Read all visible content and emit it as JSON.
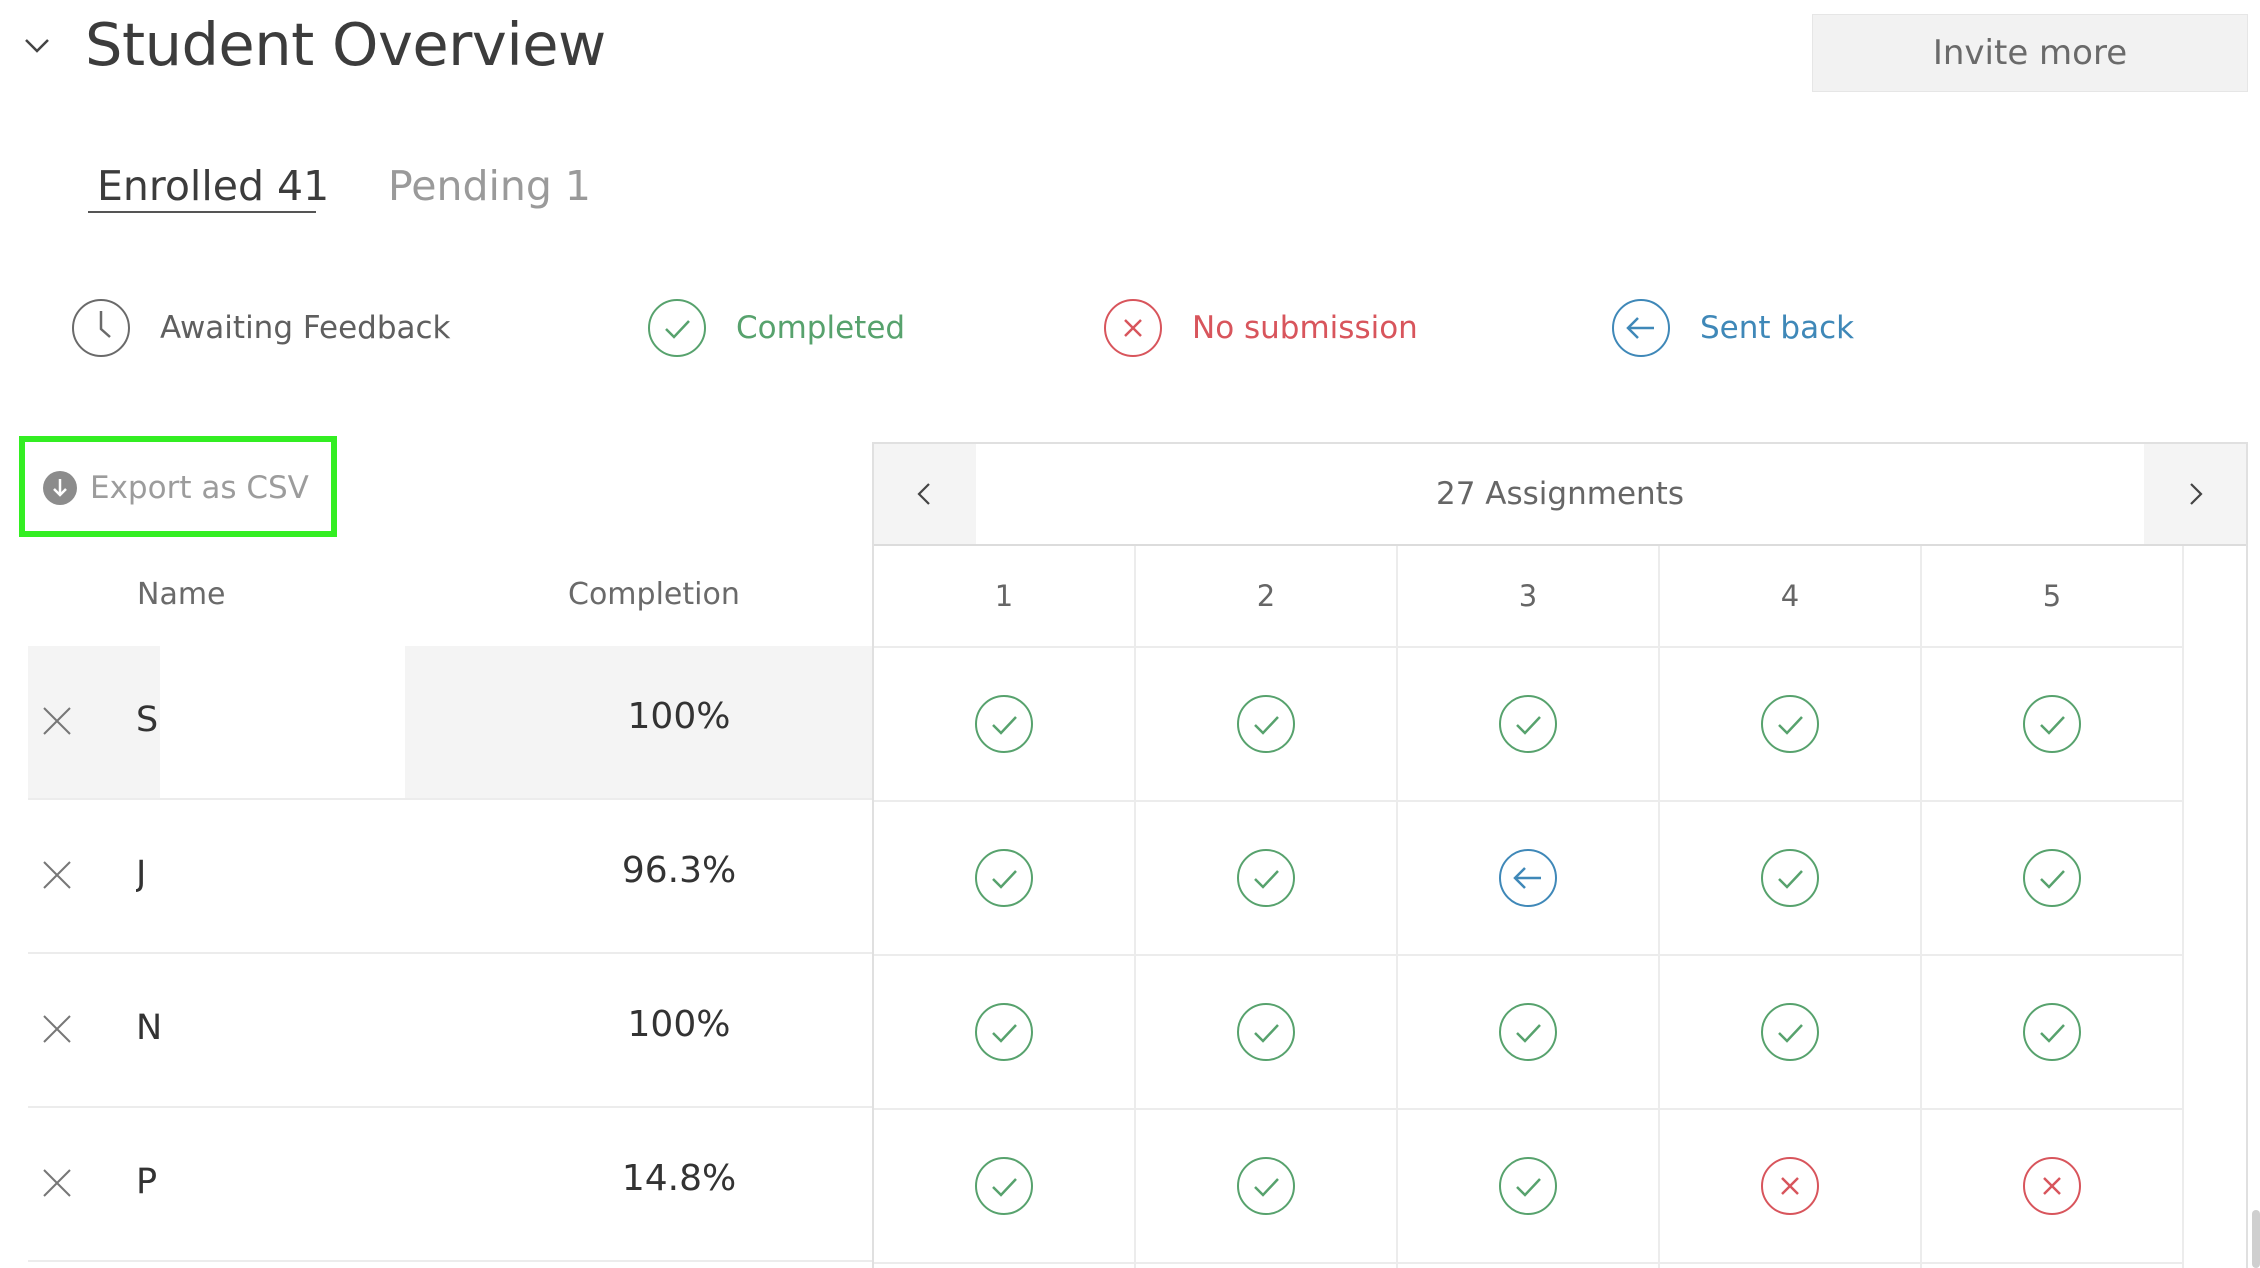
{
  "header": {
    "title": "Student Overview",
    "invite_label": "Invite more"
  },
  "tabs": [
    {
      "label": "Enrolled 41",
      "active": true
    },
    {
      "label": "Pending 1",
      "active": false
    }
  ],
  "legend": {
    "awaiting": "Awaiting Feedback",
    "completed": "Completed",
    "no_submission": "No submission",
    "sent_back": "Sent back"
  },
  "colors": {
    "completed": "#57a26d",
    "no_submission": "#d8555c",
    "sent_back": "#3f88b8",
    "awaiting": "#6a6a6a",
    "highlight_box": "#33ee22"
  },
  "export_label": "Export as CSV",
  "table": {
    "name_header": "Name",
    "completion_header": "Completion",
    "assignments_title": "27 Assignments",
    "assignment_columns": [
      "1",
      "2",
      "3",
      "4",
      "5"
    ],
    "rows": [
      {
        "initial": "S",
        "completion": "100%",
        "statuses": [
          "completed",
          "completed",
          "completed",
          "completed",
          "completed"
        ]
      },
      {
        "initial": "J",
        "completion": "96.3%",
        "statuses": [
          "completed",
          "completed",
          "sent_back",
          "completed",
          "completed"
        ]
      },
      {
        "initial": "N",
        "completion": "100%",
        "statuses": [
          "completed",
          "completed",
          "completed",
          "completed",
          "completed"
        ]
      },
      {
        "initial": "P",
        "completion": "14.8%",
        "statuses": [
          "completed",
          "completed",
          "completed",
          "no_submission",
          "no_submission"
        ]
      }
    ]
  }
}
